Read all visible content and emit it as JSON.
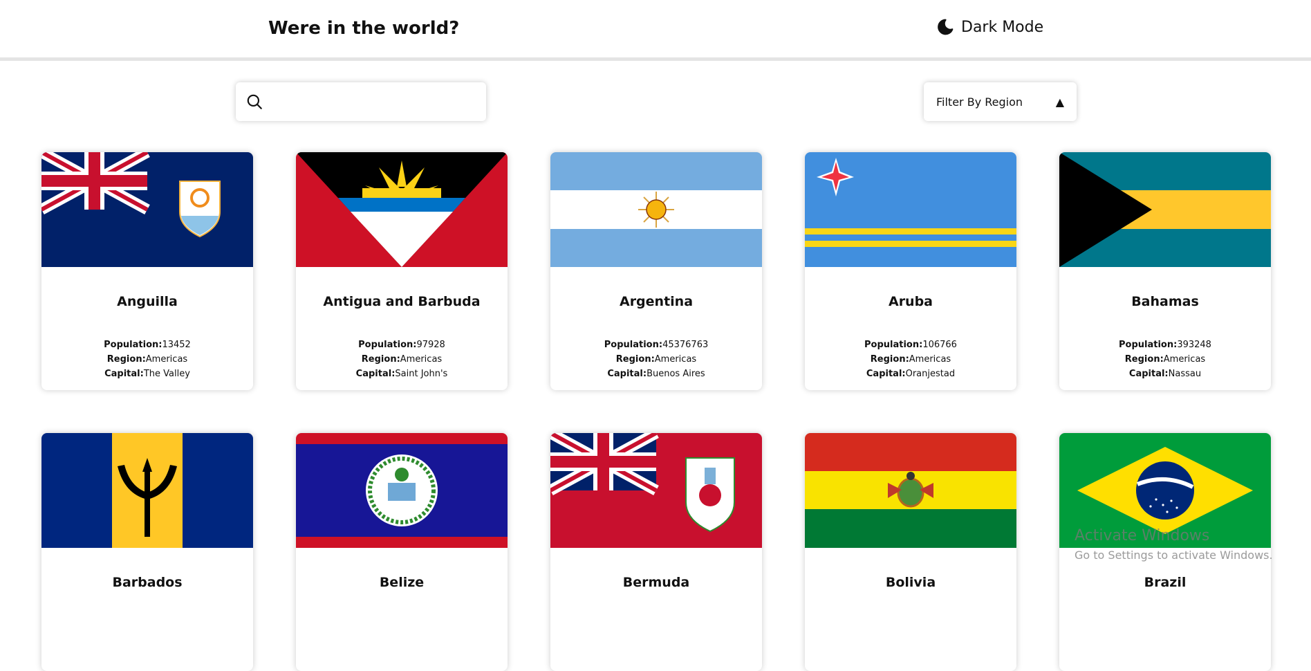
{
  "header": {
    "title": "Were in the world?",
    "dark_mode_label": "Dark Mode"
  },
  "search": {
    "value": "",
    "placeholder": ""
  },
  "filter": {
    "label": "Filter By Region",
    "caret": "▲"
  },
  "labels": {
    "population": "Population:",
    "region": "Region:",
    "capital": "Capital:"
  },
  "countries": [
    {
      "name": "Anguilla",
      "population": "13452",
      "region": "Americas",
      "capital": "The Valley",
      "flag_icon": "anguilla-flag-icon"
    },
    {
      "name": "Antigua and Barbuda",
      "population": "97928",
      "region": "Americas",
      "capital": "Saint John's",
      "flag_icon": "antigua-and-barbuda-flag-icon"
    },
    {
      "name": "Argentina",
      "population": "45376763",
      "region": "Americas",
      "capital": "Buenos Aires",
      "flag_icon": "argentina-flag-icon"
    },
    {
      "name": "Aruba",
      "population": "106766",
      "region": "Americas",
      "capital": "Oranjestad",
      "flag_icon": "aruba-flag-icon"
    },
    {
      "name": "Bahamas",
      "population": "393248",
      "region": "Americas",
      "capital": "Nassau",
      "flag_icon": "bahamas-flag-icon"
    },
    {
      "name": "Barbados",
      "flag_icon": "barbados-flag-icon"
    },
    {
      "name": "Belize",
      "flag_icon": "belize-flag-icon"
    },
    {
      "name": "Bermuda",
      "flag_icon": "bermuda-flag-icon"
    },
    {
      "name": "Bolivia",
      "flag_icon": "bolivia-flag-icon"
    },
    {
      "name": "Brazil",
      "flag_icon": "brazil-flag-icon"
    }
  ],
  "watermark": {
    "line1": "Activate Windows",
    "line2": "Go to Settings to activate Windows."
  }
}
